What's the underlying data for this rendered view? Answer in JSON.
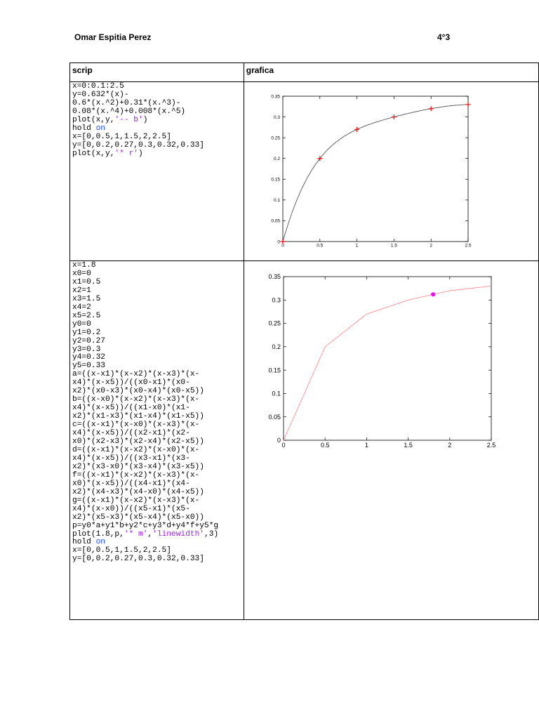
{
  "header": {
    "author": "Omar Espitia Perez",
    "section": "4°3"
  },
  "table": {
    "col1_header": "scrip",
    "col2_header": "grafica"
  },
  "row1": {
    "script": [
      [
        {
          "t": "x=0:0.1:2.5"
        }
      ],
      [
        {
          "t": "y=0.632*(x)-"
        }
      ],
      [
        {
          "t": "0.6*(x.^2)+0.31*(x.^3)-"
        }
      ],
      [
        {
          "t": "0.08*(x.^4)+0.008*(x.^5)"
        }
      ],
      [
        {
          "t": "plot(x,y,"
        },
        {
          "t": "'-- b'",
          "c": "str"
        },
        {
          "t": ")"
        }
      ],
      [
        {
          "t": "hold "
        },
        {
          "t": "on",
          "c": "kw"
        }
      ],
      [
        {
          "t": "x=[0,0.5,1,1.5,2,2.5]"
        }
      ],
      [
        {
          "t": "y=[0,0.2,0.27,0.3,0.32,0.33]"
        }
      ],
      [
        {
          "t": "plot(x,y,"
        },
        {
          "t": "'* r'",
          "c": "str"
        },
        {
          "t": ")"
        }
      ]
    ]
  },
  "row2": {
    "script": [
      [
        {
          "t": "x=1.8"
        }
      ],
      [
        {
          "t": "x0=0"
        }
      ],
      [
        {
          "t": "x1=0.5"
        }
      ],
      [
        {
          "t": "x2=1"
        }
      ],
      [
        {
          "t": "x3=1.5"
        }
      ],
      [
        {
          "t": "x4=2"
        }
      ],
      [
        {
          "t": "x5=2.5"
        }
      ],
      [
        {
          "t": "y0=0"
        }
      ],
      [
        {
          "t": "y1=0.2"
        }
      ],
      [
        {
          "t": "y2=0.27"
        }
      ],
      [
        {
          "t": "y3=0.3"
        }
      ],
      [
        {
          "t": "y4=0.32"
        }
      ],
      [
        {
          "t": "y5=0.33"
        }
      ],
      [
        {
          "t": "a=((x-x1)*(x-x2)*(x-x3)*(x-"
        }
      ],
      [
        {
          "t": "x4)*(x-x5))/((x0-x1)*(x0-"
        }
      ],
      [
        {
          "t": "x2)*(x0-x3)*(x0-x4)*(x0-x5))"
        }
      ],
      [
        {
          "t": "b=((x-x0)*(x-x2)*(x-x3)*(x-"
        }
      ],
      [
        {
          "t": "x4)*(x-x5))/((x1-x0)*(x1-"
        }
      ],
      [
        {
          "t": "x2)*(x1-x3)*(x1-x4)*(x1-x5))"
        }
      ],
      [
        {
          "t": "c=((x-x1)*(x-x0)*(x-x3)*(x-"
        }
      ],
      [
        {
          "t": "x4)*(x-x5))/((x2-x1)*(x2-"
        }
      ],
      [
        {
          "t": "x0)*(x2-x3)*(x2-x4)*(x2-x5))"
        }
      ],
      [
        {
          "t": "d=((x-x1)*(x-x2)*(x-x0)*(x-"
        }
      ],
      [
        {
          "t": "x4)*(x-x5))/((x3-x1)*(x3-"
        }
      ],
      [
        {
          "t": "x2)*(x3-x0)*(x3-x4)*(x3-x5))"
        }
      ],
      [
        {
          "t": "f=((x-x1)*(x-x2)*(x-x3)*(x-"
        }
      ],
      [
        {
          "t": "x0)*(x-x5))/((x4-x1)*(x4-"
        }
      ],
      [
        {
          "t": "x2)*(x4-x3)*(x4-x0)*(x4-x5))"
        }
      ],
      [
        {
          "t": "g=((x-x1)*(x-x2)*(x-x3)*(x-"
        }
      ],
      [
        {
          "t": "x4)*(x-x0))/((x5-x1)*(x5-"
        }
      ],
      [
        {
          "t": "x2)*(x5-x3)*(x5-x4)*(x5-x0))"
        }
      ],
      [
        {
          "t": "p=y0*a+y1*b+y2*c+y3*d+y4*f+y5*g"
        }
      ],
      [
        {
          "t": "plot(1.8,p,"
        },
        {
          "t": "'* m'",
          "c": "str"
        },
        {
          "t": ","
        },
        {
          "t": "'linewidth'",
          "c": "str"
        },
        {
          "t": ",3)"
        }
      ],
      [
        {
          "t": "hold "
        },
        {
          "t": "on",
          "c": "kw"
        }
      ],
      [
        {
          "t": "x=[0,0.5,1,1.5,2,2.5]"
        }
      ],
      [
        {
          "t": "y=[0,0.2,0.27,0.3,0.32,0.33]"
        }
      ]
    ]
  },
  "colors": {
    "keyword": "#1f4fff",
    "string": "#a020f0",
    "curve1": "#555555",
    "markers1": "#ff0000",
    "line2": "#ff9090",
    "marker2": "#ff00ff"
  },
  "chart_data": [
    {
      "type": "line",
      "xlim": [
        0,
        2.5
      ],
      "ylim": [
        0,
        0.35
      ],
      "xticks": [
        "0",
        "0.5",
        "1",
        "1.5",
        "2",
        "2.5"
      ],
      "yticks": [
        "0",
        "0.05",
        "0.1",
        "0.15",
        "0.2",
        "0.25",
        "0.3",
        "0.35"
      ],
      "grid": false,
      "series": [
        {
          "style": "line",
          "color": "#555555",
          "equation": "0.632x-0.6x^2+0.31x^3-0.08x^4+0.008x^5",
          "x_range": [
            0,
            2.5
          ]
        },
        {
          "style": "markers",
          "marker": "+",
          "color": "#ff0000",
          "x": [
            0,
            0.5,
            1,
            1.5,
            2,
            2.5
          ],
          "y": [
            0,
            0.2,
            0.27,
            0.3,
            0.32,
            0.33
          ]
        }
      ]
    },
    {
      "type": "line",
      "xlim": [
        0,
        2.5
      ],
      "ylim": [
        0,
        0.35
      ],
      "xticks": [
        "0",
        "0.5",
        "1",
        "1.5",
        "2",
        "2.5"
      ],
      "yticks": [
        "0",
        "0.05",
        "0.1",
        "0.15",
        "0.2",
        "0.25",
        "0.3",
        "0.35"
      ],
      "grid": false,
      "series": [
        {
          "style": "line",
          "color": "#ff9090",
          "x": [
            0,
            0.5,
            1,
            1.5,
            2,
            2.5
          ],
          "y": [
            0,
            0.2,
            0.27,
            0.3,
            0.32,
            0.33
          ]
        },
        {
          "style": "markers",
          "marker": "*",
          "color": "#ff00ff",
          "x": [
            1.8
          ],
          "y": [
            0.312
          ]
        }
      ]
    }
  ]
}
